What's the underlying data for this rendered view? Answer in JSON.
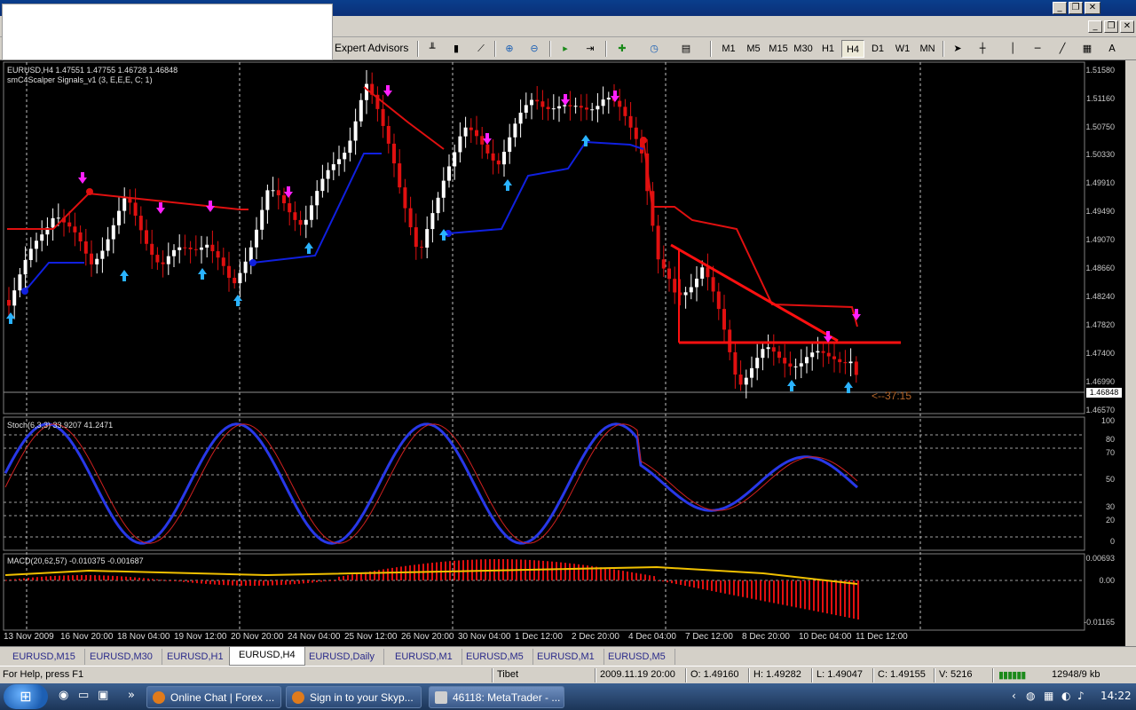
{
  "toolbar": {
    "expert_advisors_label": "Expert Advisors",
    "timeframes": [
      "M1",
      "M5",
      "M15",
      "M30",
      "H1",
      "H4",
      "D1",
      "W1",
      "MN"
    ],
    "active_timeframe": "H4"
  },
  "chart": {
    "header": "EURUSD,H4  1.47551 1.47755 1.46728 1.46848",
    "indicator_label": "smC4Scalper Signals_v1 (3, E,E,E, C; 1)",
    "current_price": "1.46848",
    "countdown": "<--37:15",
    "price_axis": [
      "1.51580",
      "1.51160",
      "1.50750",
      "1.50330",
      "1.49910",
      "1.49490",
      "1.49070",
      "1.48660",
      "1.48240",
      "1.47820",
      "1.47400",
      "1.46990",
      "1.46570"
    ],
    "stoch": {
      "label": "Stoch(6,3,3) 33.9207 41.2471",
      "levels": [
        "100",
        "80",
        "70",
        "50",
        "30",
        "20",
        "0"
      ]
    },
    "macd": {
      "label": "MACD(20,62,57) -0.010375 -0.001687",
      "levels": [
        "0.00693",
        "0.00",
        "-0.01165"
      ]
    },
    "dates": [
      "13 Nov 2009",
      "16 Nov 20:00",
      "18 Nov 04:00",
      "19 Nov 12:00",
      "20 Nov 20:00",
      "24 Nov 04:00",
      "25 Nov 12:00",
      "26 Nov 20:00",
      "30 Nov 04:00",
      "1 Dec 12:00",
      "2 Dec 20:00",
      "4 Dec 04:00",
      "7 Dec 12:00",
      "8 Dec 20:00",
      "10 Dec 04:00",
      "11 Dec 12:00"
    ],
    "colors": {
      "bull": "#ffffff",
      "bear": "#e01010",
      "upper_band": "#e01010",
      "lower_band": "#1020e0",
      "sell_arrow": "#ff20ff",
      "buy_arrow": "#2ab3ff",
      "stoch_main": "#2838e8",
      "stoch_signal": "#d02020",
      "macd_hist": "#e01010",
      "macd_signal": "#f0c000"
    }
  },
  "tabs": [
    "EURUSD,M15",
    "EURUSD,M30",
    "EURUSD,H1",
    "EURUSD,H4",
    "EURUSD,Daily",
    "EURUSD,M1",
    "EURUSD,M5",
    "EURUSD,M1",
    "EURUSD,M5"
  ],
  "active_tab": "EURUSD,H4",
  "status": {
    "help": "For Help, press F1",
    "profile": "Tibet",
    "time": "2009.11.19 20:00",
    "open": "O: 1.49160",
    "high": "H: 1.49282",
    "low": "L: 1.49047",
    "close": "C: 1.49155",
    "volume": "V: 5216",
    "traffic": "12948/9 kb"
  },
  "taskbar": {
    "tasks": [
      "Online Chat | Forex ...",
      "Sign in to your Skyp...",
      "46118: MetaTrader - ..."
    ],
    "clock": "14:22"
  }
}
